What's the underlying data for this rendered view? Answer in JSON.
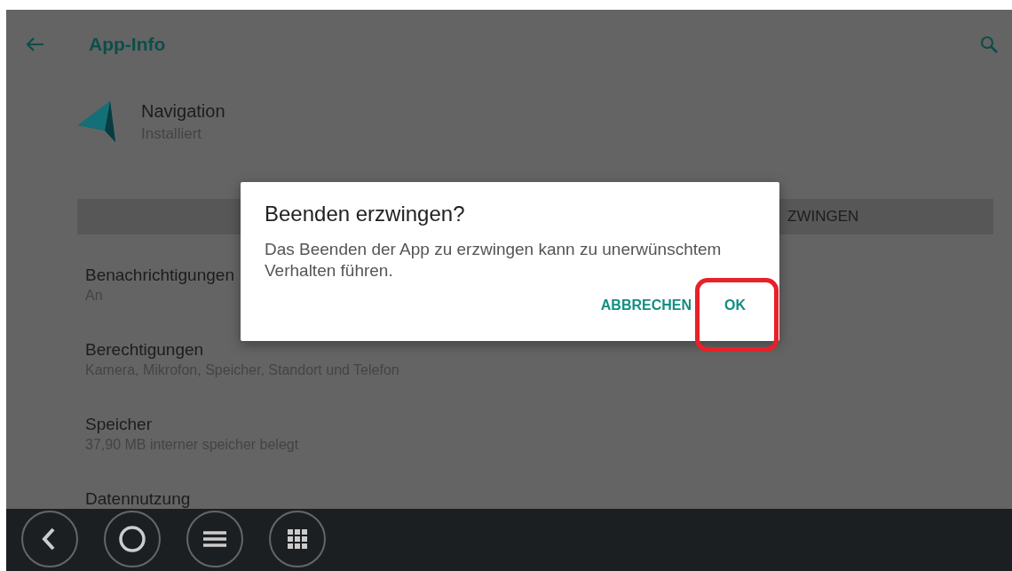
{
  "app_bar": {
    "title": "App-Info"
  },
  "app": {
    "name": "Navigation",
    "status": "Installiert"
  },
  "action_bar": {
    "visible_label": "ZWINGEN"
  },
  "settings": [
    {
      "title": "Benachrichtigungen",
      "subtitle": "An"
    },
    {
      "title": "Berechtigungen",
      "subtitle": "Kamera, Mikrofon, Speicher, Standort und Telefon"
    },
    {
      "title": "Speicher",
      "subtitle": "37,90 MB interner speicher belegt"
    },
    {
      "title": "Datennutzung"
    }
  ],
  "dialog": {
    "title": "Beenden erzwingen?",
    "message": "Das Beenden der App zu erzwingen kann zu unerwünschtem Verhalten führen.",
    "buttons": [
      {
        "label": "ABBRECHEN",
        "highlighted": false
      },
      {
        "label": "OK",
        "highlighted": true
      }
    ]
  },
  "nav_bar": {
    "buttons": [
      {
        "kind": "back"
      },
      {
        "kind": "home"
      },
      {
        "kind": "menu"
      },
      {
        "kind": "apps"
      }
    ]
  }
}
